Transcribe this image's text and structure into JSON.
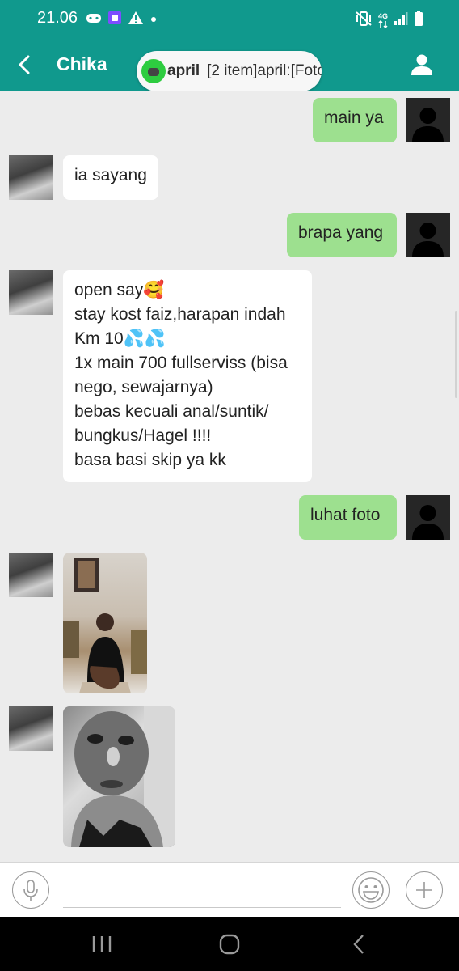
{
  "status_bar": {
    "time": "21.06",
    "left_icons": [
      "game-controller-icon",
      "screen-record-icon",
      "warning-icon",
      "dot-icon"
    ],
    "right_icons": [
      "vibrate-icon",
      "network-4g-icon",
      "signal-icon",
      "battery-icon"
    ],
    "network_label": "4G"
  },
  "app_bar": {
    "title": "Chika",
    "back_icon": "chevron-left-icon",
    "profile_icon": "person-icon"
  },
  "notification": {
    "sender": "april",
    "text": "[2 item]april:[Foto]"
  },
  "messages": [
    {
      "side": "out",
      "type": "text",
      "text": "main ya"
    },
    {
      "side": "in",
      "type": "text",
      "text": "ia sayang"
    },
    {
      "side": "out",
      "type": "text",
      "text": "brapa yang"
    },
    {
      "side": "in",
      "type": "text",
      "text": "open say🥰\nstay kost faiz,harapan indah\nKm 10💦💦\n1x main 700 fullserviss (bisa\nnego, sewajarnya)\nbebas kecuali anal/suntik/\nbungkus/Hagel !!!!\nbasa basi skip ya kk"
    },
    {
      "side": "out",
      "type": "text",
      "text": "luhat foto"
    },
    {
      "side": "in",
      "type": "photo"
    },
    {
      "side": "in",
      "type": "photo"
    }
  ],
  "input_bar": {
    "placeholder": "",
    "mic_icon": "microphone-icon",
    "emoji_icon": "emoji-icon",
    "add_icon": "plus-icon"
  },
  "nav_bar": {
    "icons": [
      "recent-apps-icon",
      "home-icon",
      "back-icon"
    ]
  },
  "colors": {
    "accent": "#10998d",
    "outgoing_bubble": "#9de08f",
    "incoming_bubble": "#ffffff",
    "chat_background": "#ececec",
    "notification_dot": "#2ecc40"
  }
}
